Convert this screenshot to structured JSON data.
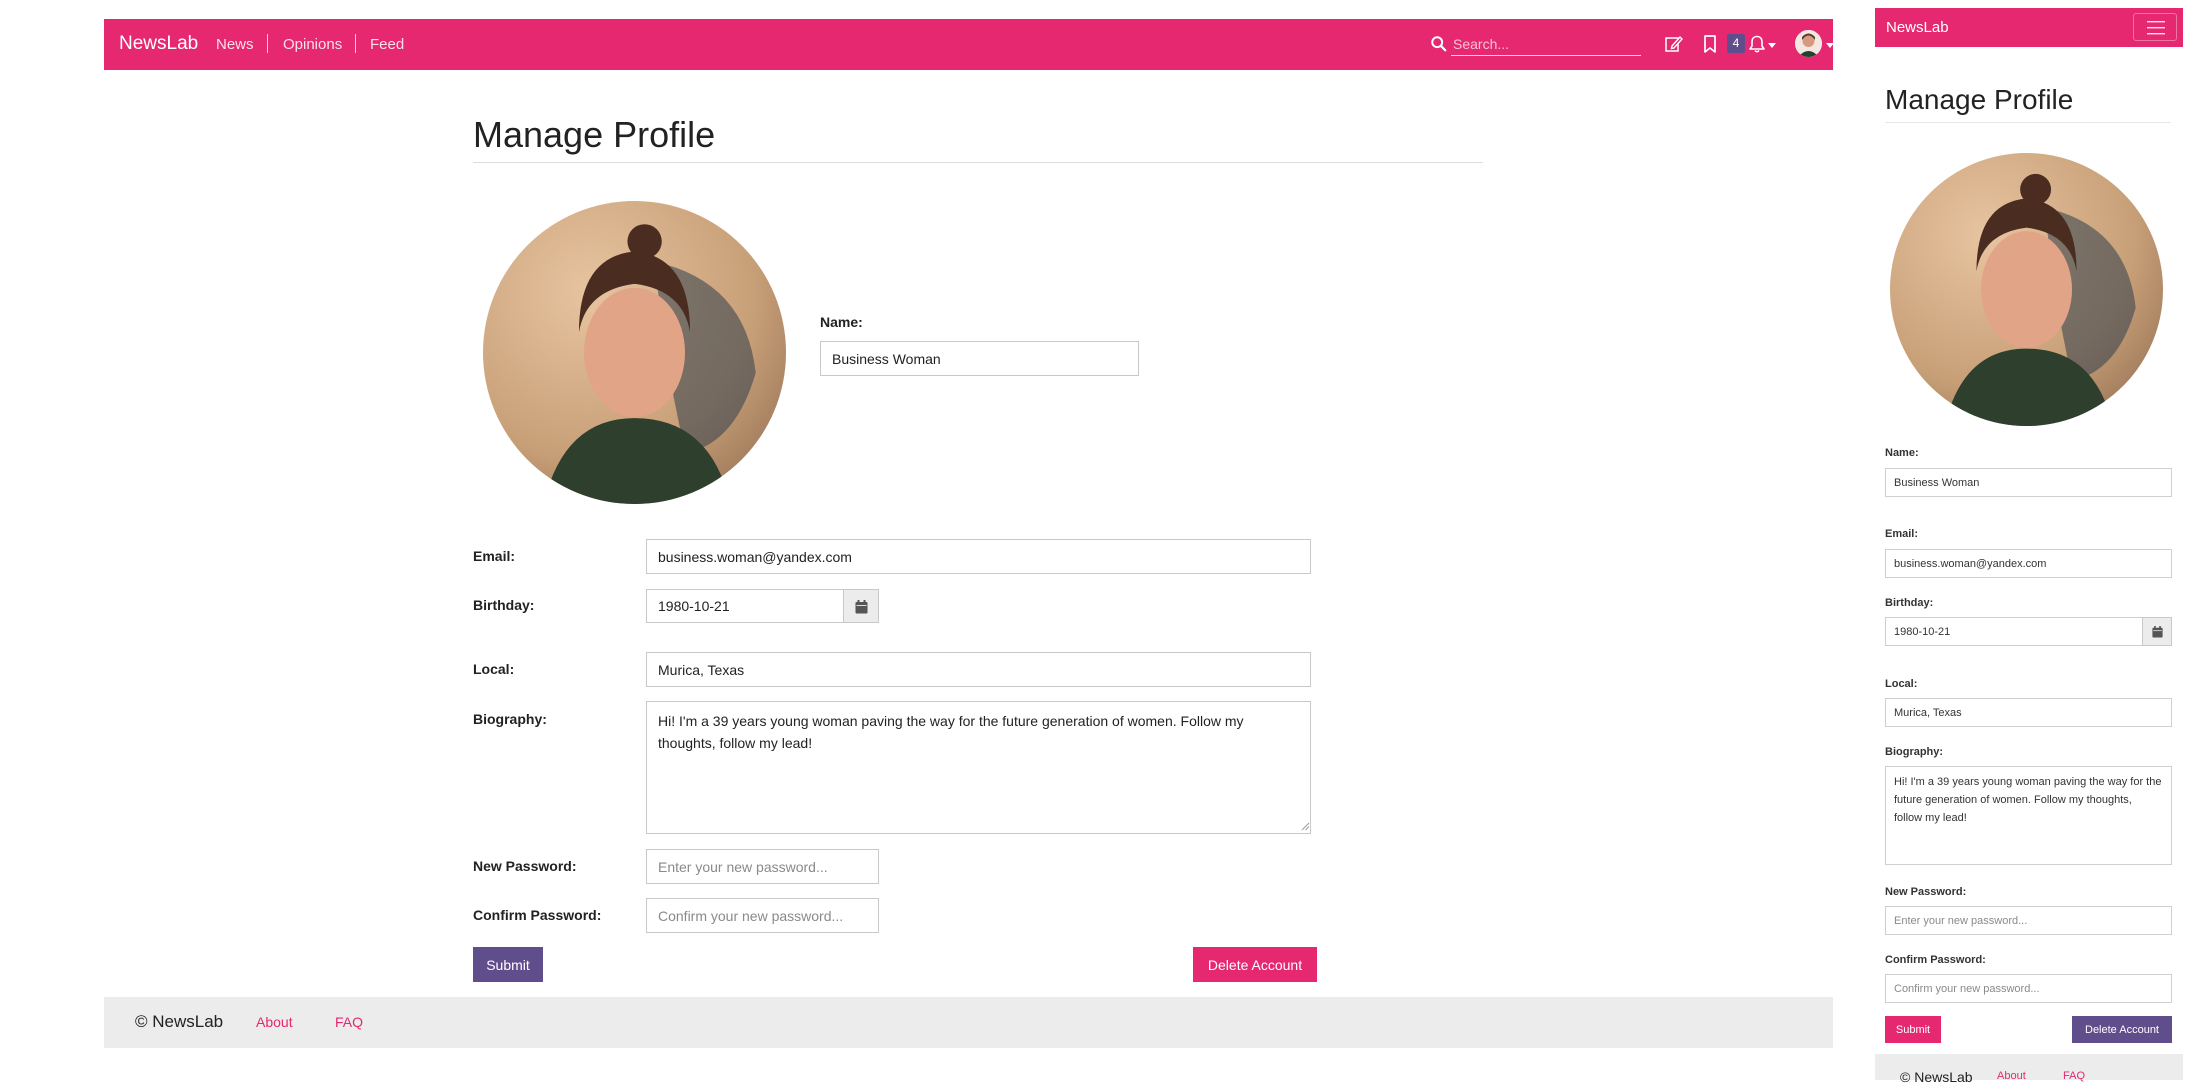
{
  "navbar": {
    "brand": "NewsLab",
    "links": [
      "News",
      "Opinions",
      "Feed"
    ],
    "search_placeholder": "Search...",
    "notification_count": "4"
  },
  "profile": {
    "title": "Manage Profile",
    "name_label": "Name:",
    "name_value": "Business Woman",
    "email_label": "Email:",
    "email_value": "business.woman@yandex.com",
    "birthday_label": "Birthday:",
    "birthday_value": "1980-10-21",
    "local_label": "Local:",
    "local_value": "Murica, Texas",
    "biography_label": "Biography:",
    "biography_value": "Hi! I'm a 39 years young woman paving the way for the future generation of women. Follow my thoughts, follow my lead!",
    "new_password_label": "New Password:",
    "new_password_placeholder": "Enter your new password...",
    "confirm_password_label": "Confirm Password:",
    "confirm_password_placeholder": "Confirm your new password...",
    "submit_label": "Submit",
    "delete_label": "Delete Account"
  },
  "footer": {
    "copyright": "© NewsLab",
    "links": [
      "About",
      "FAQ"
    ]
  },
  "icons": {
    "search": "search-icon",
    "edit": "edit-icon",
    "bookmark": "bookmark-icon",
    "bell": "bell-icon",
    "calendar": "calendar-icon",
    "menu": "hamburger-menu-icon"
  },
  "colors": {
    "brand_pink": "#e5286f",
    "brand_purple": "#604d8c",
    "footer_gray": "#ececec"
  }
}
